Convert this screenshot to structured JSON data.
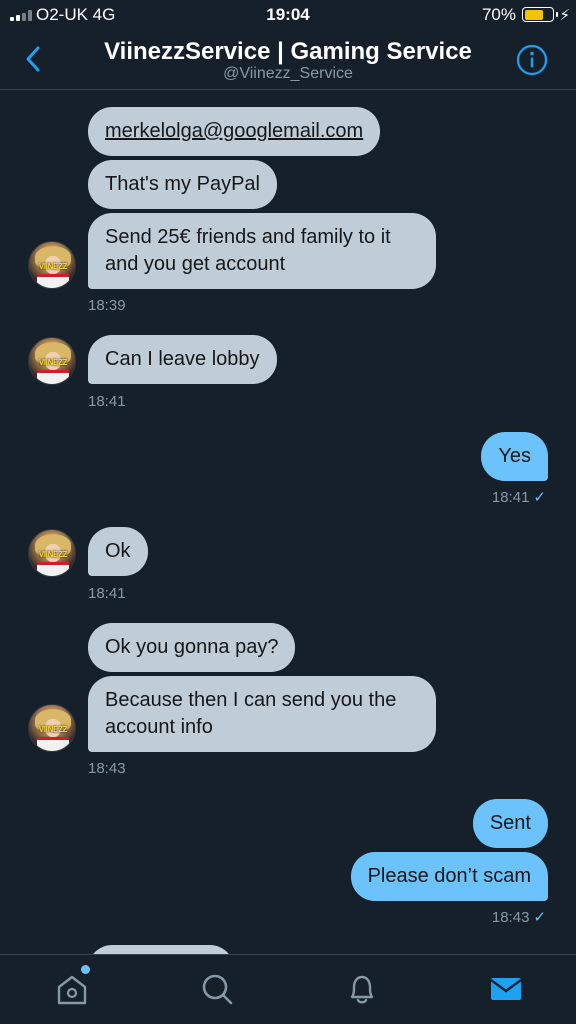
{
  "status_bar": {
    "carrier": "O2-UK  4G",
    "time": "19:04",
    "battery": "70%",
    "battery_level": 0.7
  },
  "header": {
    "title": "ViinezzService | Gaming Service",
    "handle": "@Viinezz_Service"
  },
  "avatar_text": "VIINEZZ",
  "messages": {
    "m1": "merkelolga@googlemail.com",
    "m2": "That's my PayPal",
    "m3a": "Send 25€ friends and family to it",
    "m3b": "and you get account",
    "t1": "18:39",
    "m4": "Can I leave lobby",
    "t2": "18:41",
    "m5": "Yes",
    "t3": "18:41",
    "m6": "Ok",
    "t4": "18:41",
    "m7": "Ok you gonna pay?",
    "m8a": "Because then I can send you the",
    "m8b": "account info",
    "t5": "18:43",
    "m9": "Sent",
    "m10": "Please don’t scam",
    "t6": "18:43"
  },
  "colors": {
    "background": "#15202b",
    "incoming": "#c0cdd6",
    "outgoing": "#6cc3fb",
    "accent": "#1da1f2"
  },
  "icons": {
    "back": "chevron-left-icon",
    "info": "info-icon",
    "home": "home-icon",
    "search": "search-icon",
    "notifications": "bell-icon",
    "messages": "mail-icon"
  }
}
